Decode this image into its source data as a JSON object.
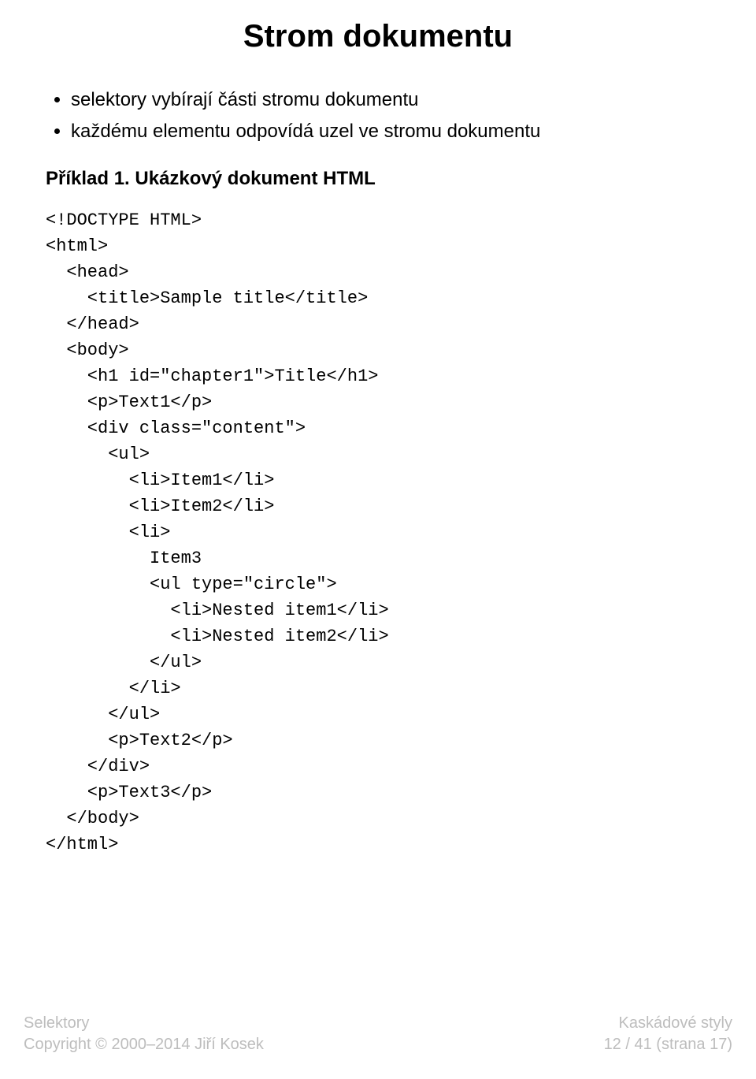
{
  "title": "Strom dokumentu",
  "bullets": [
    "selektory vybírají části stromu dokumentu",
    "každému elementu odpovídá uzel ve stromu dokumentu"
  ],
  "example": {
    "label": "Příklad 1. Ukázkový dokument HTML",
    "code": "<!DOCTYPE HTML>\n<html>\n  <head>\n    <title>Sample title</title>\n  </head>\n  <body>\n    <h1 id=\"chapter1\">Title</h1>\n    <p>Text1</p>\n    <div class=\"content\">\n      <ul>\n        <li>Item1</li>\n        <li>Item2</li>\n        <li>\n          Item3\n          <ul type=\"circle\">\n            <li>Nested item1</li>\n            <li>Nested item2</li>\n          </ul>\n        </li>\n      </ul>\n      <p>Text2</p>\n    </div>\n    <p>Text3</p>\n  </body>\n</html>"
  },
  "footer": {
    "left_line1": "Selektory",
    "left_line2": "Copyright © 2000–2014 Jiří Kosek",
    "right_line1": "Kaskádové styly",
    "right_line2": "12 / 41  (strana 17)"
  }
}
